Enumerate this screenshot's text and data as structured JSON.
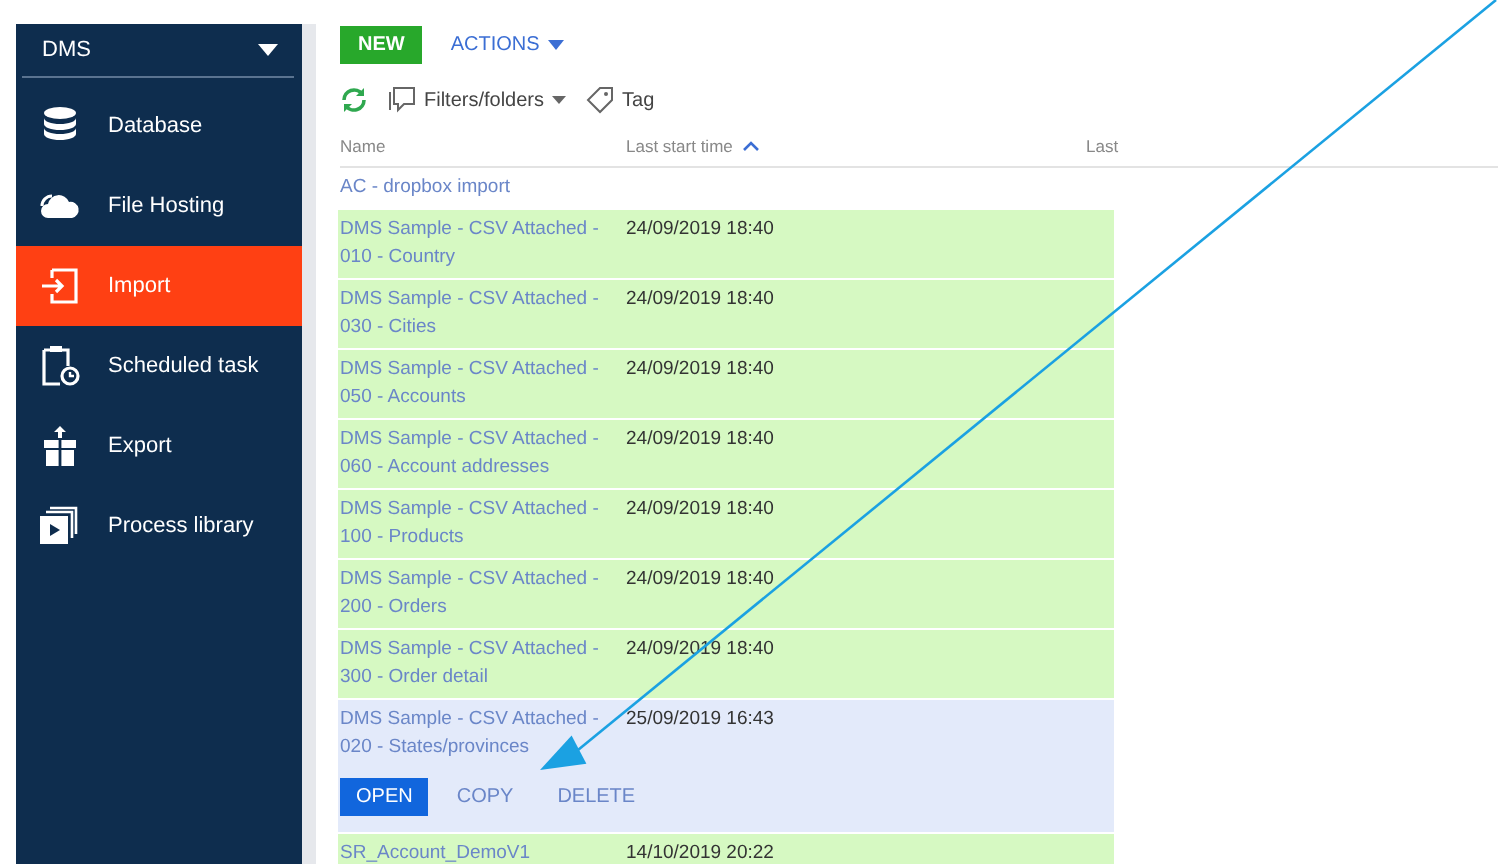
{
  "sidebar": {
    "title": "DMS",
    "items": [
      {
        "label": "Database",
        "selected": false
      },
      {
        "label": "File Hosting",
        "selected": false
      },
      {
        "label": "Import",
        "selected": true
      },
      {
        "label": "Scheduled task",
        "selected": false
      },
      {
        "label": "Export",
        "selected": false
      },
      {
        "label": "Process library",
        "selected": false
      }
    ]
  },
  "toolbar": {
    "new_button": "NEW",
    "actions_button": "ACTIONS",
    "filters": "Filters/folders",
    "tag": "Tag"
  },
  "table": {
    "columns": [
      "Name",
      "Last start time",
      "Last"
    ],
    "rows": [
      {
        "name": "AC - dropbox import",
        "time": "",
        "highlighted": false,
        "selected": false
      },
      {
        "name": "DMS Sample - CSV Attached - 010 - Country",
        "time": "24/09/2019 18:40",
        "highlighted": true,
        "selected": false
      },
      {
        "name": "DMS Sample - CSV Attached - 030 - Cities",
        "time": "24/09/2019 18:40",
        "highlighted": true,
        "selected": false
      },
      {
        "name": "DMS Sample - CSV Attached - 050 - Accounts",
        "time": "24/09/2019 18:40",
        "highlighted": true,
        "selected": false
      },
      {
        "name": "DMS Sample - CSV Attached - 060 - Account addresses",
        "time": "24/09/2019 18:40",
        "highlighted": true,
        "selected": false
      },
      {
        "name": "DMS Sample - CSV Attached - 100 - Products",
        "time": "24/09/2019 18:40",
        "highlighted": true,
        "selected": false
      },
      {
        "name": "DMS Sample - CSV Attached - 200 - Orders",
        "time": "24/09/2019 18:40",
        "highlighted": true,
        "selected": false
      },
      {
        "name": "DMS Sample - CSV Attached - 300 - Order detail",
        "time": "24/09/2019 18:40",
        "highlighted": true,
        "selected": false
      },
      {
        "name": "DMS Sample - CSV Attached - 020 - States/provinces",
        "time": "25/09/2019 16:43",
        "highlighted": false,
        "selected": true
      },
      {
        "name": "SR_Account_DemoV1",
        "time": "14/10/2019 20:22",
        "highlighted": true,
        "selected": false
      }
    ],
    "row_actions": [
      "OPEN",
      "COPY",
      "DELETE"
    ]
  }
}
